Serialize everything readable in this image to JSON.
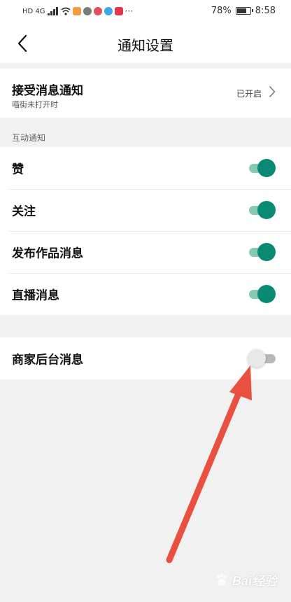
{
  "status_bar": {
    "left_text": "HD 4G",
    "battery": "78%",
    "battery_fraction": 0.78,
    "time": "8:58",
    "notification_colors": [
      "#f59a3a",
      "#7a7a7a",
      "#e34c5a",
      "#3aa8e4",
      "#e2374b"
    ]
  },
  "header": {
    "title": "通知设置"
  },
  "main_setting": {
    "title": "接受消息通知",
    "subtitle": "喵街未打开时",
    "status": "已开启"
  },
  "section_label": "互动通知",
  "interaction_items": [
    {
      "label": "赞",
      "enabled": true
    },
    {
      "label": "关注",
      "enabled": true
    },
    {
      "label": "发布作品消息",
      "enabled": true
    },
    {
      "label": "直播消息",
      "enabled": true
    }
  ],
  "merchant_item": {
    "label": "商家后台消息",
    "enabled": false
  },
  "watermark": {
    "text": "Bai经验"
  },
  "colors": {
    "accent": "#0b8a73",
    "accent_track": "#86cab6",
    "arrow": "#e9503f",
    "background": "#f1f1f1"
  }
}
